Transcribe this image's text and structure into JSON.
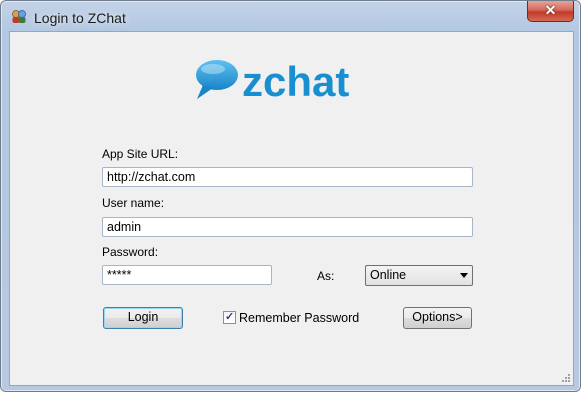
{
  "window": {
    "title": "Login to ZChat",
    "close_label": "✕"
  },
  "logo": {
    "text": "zchat",
    "color": "#1a8fcf"
  },
  "form": {
    "url_label": "App Site URL:",
    "url_value": "http://zchat.com",
    "username_label": "User name:",
    "username_value": "admin",
    "password_label": "Password:",
    "password_value": "*****",
    "status_label": "As:",
    "status_value": "Online",
    "login_button": "Login",
    "remember_label": "Remember Password",
    "remember_checked": true,
    "options_button": "Options>"
  },
  "icons": {
    "app": "app-icon",
    "close": "close-icon",
    "dropdown": "chevron-down-icon",
    "check": "check-icon",
    "grip": "resize-grip-icon"
  }
}
